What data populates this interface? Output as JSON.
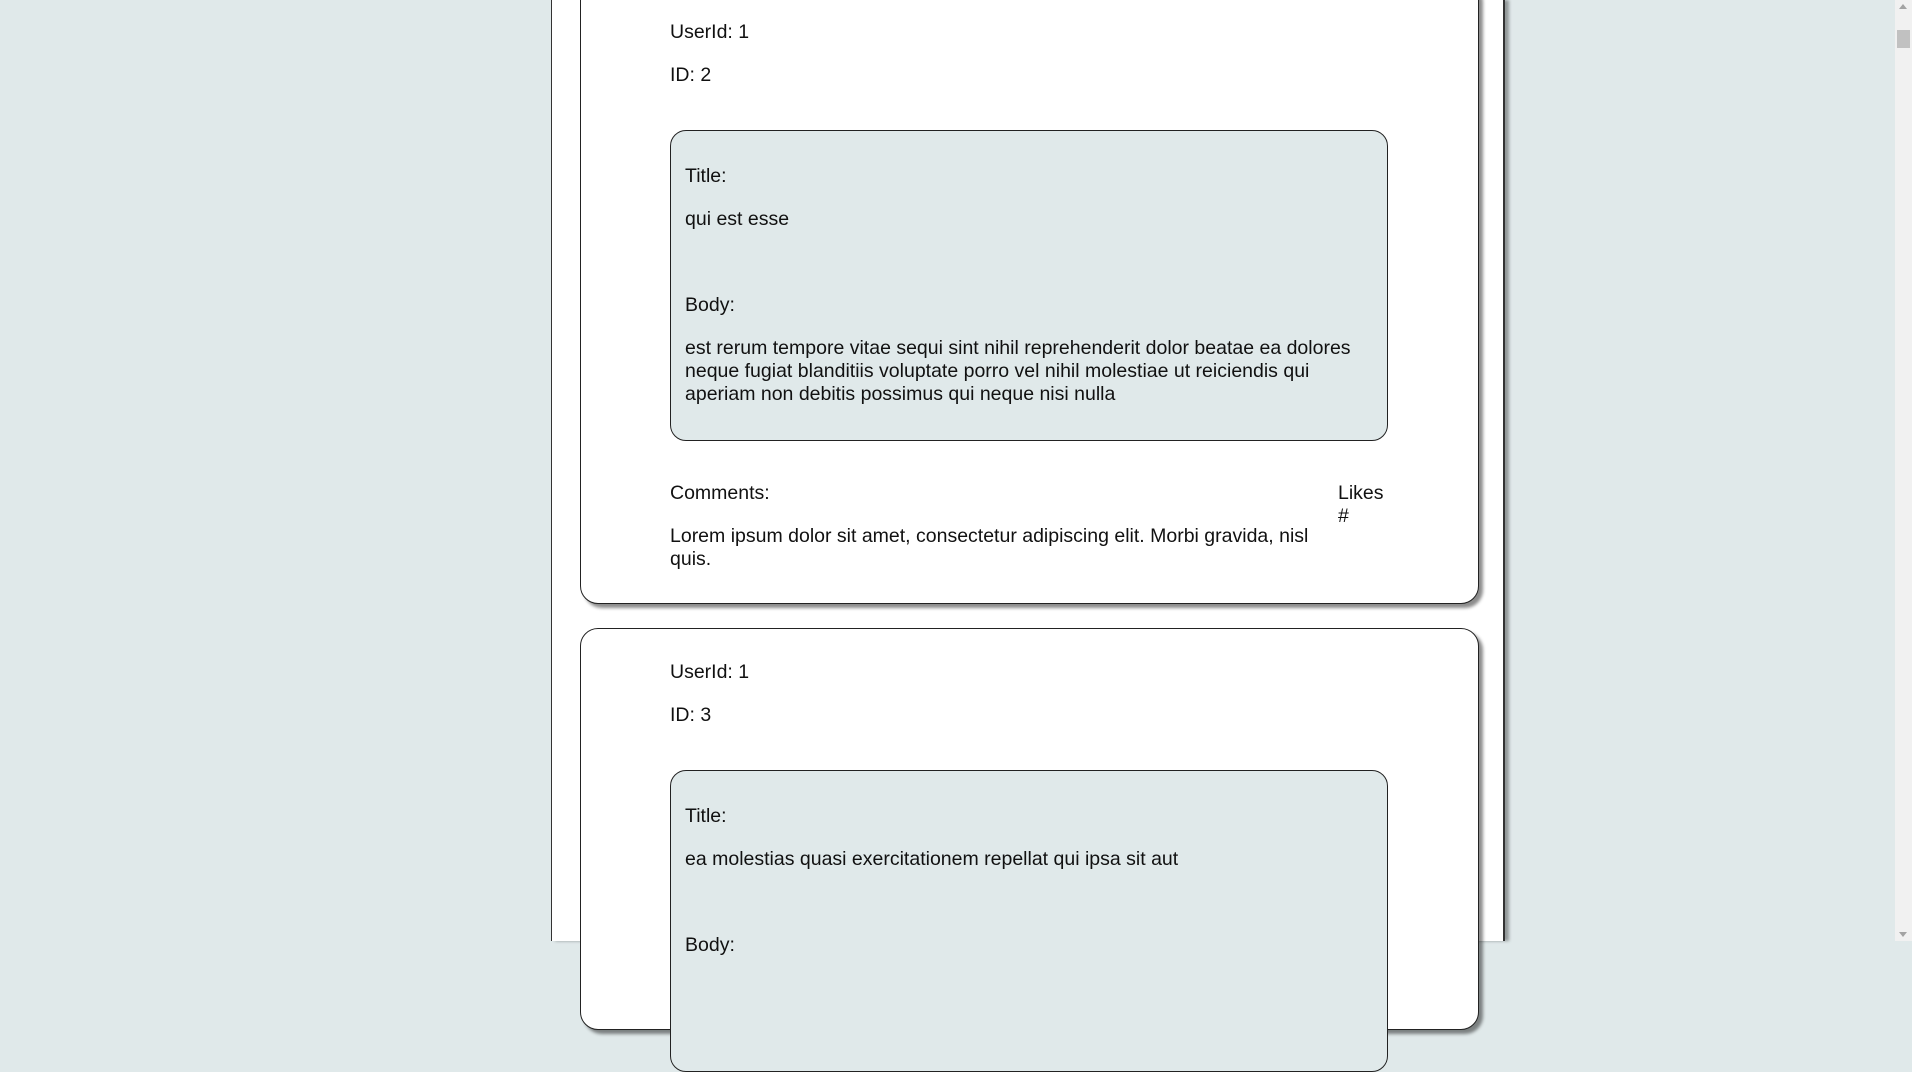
{
  "posts": [
    {
      "user_id": "UserId: 1",
      "id": "ID: 2",
      "title_label": "Title:",
      "title": "qui est esse",
      "body_label": "Body:",
      "body": "est rerum tempore vitae sequi sint nihil reprehenderit dolor beatae ea dolores neque fugiat blanditiis voluptate porro vel nihil molestiae ut reiciendis qui aperiam non debitis possimus qui neque nisi nulla",
      "comments_label": "Comments:",
      "comment": "Lorem ipsum dolor sit amet, consectetur adipiscing elit. Morbi gravida, nisl quis.",
      "likes": "Likes #"
    },
    {
      "user_id": "UserId: 1",
      "id": "ID: 3",
      "title_label": "Title:",
      "title": "ea molestias quasi exercitationem repellat qui ipsa sit aut",
      "body_label": "Body:"
    }
  ],
  "colors": {
    "page_background": "#e0e9ea",
    "card_background": "#ffffff",
    "inner_background": "#e0e9ea",
    "border": "#222222"
  }
}
